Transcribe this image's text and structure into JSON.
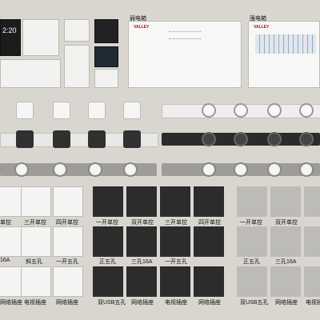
{
  "boxes": {
    "weak_box_title": "弱电箱",
    "strong_box_title": "强电箱",
    "brand": "VALLEY"
  },
  "screen": {
    "time": "2:20"
  },
  "row_labels": {
    "row1": [
      "单控",
      "三开单控",
      "四开单控",
      "一开单控",
      "双开单控",
      "三开单控",
      "四开单控",
      "一开单控",
      "双开单控"
    ],
    "row2": [
      "16A",
      "斜五孔",
      "一开五孔",
      "正五孔",
      "三孔16A",
      "一开五孔",
      "正五孔",
      "三孔16A"
    ],
    "row3": [
      "网络插座",
      "电视插座",
      "网络插座",
      "双USB五孔",
      "网络插座",
      "电视插座",
      "网络插座",
      "双USB五孔",
      "网络插座",
      "电视插"
    ]
  },
  "colors": {
    "background": "#d9d6d0",
    "white_panel": "#f2f2f0",
    "black_panel": "#2a2a2a",
    "grey_panel": "#b9b7b3"
  }
}
